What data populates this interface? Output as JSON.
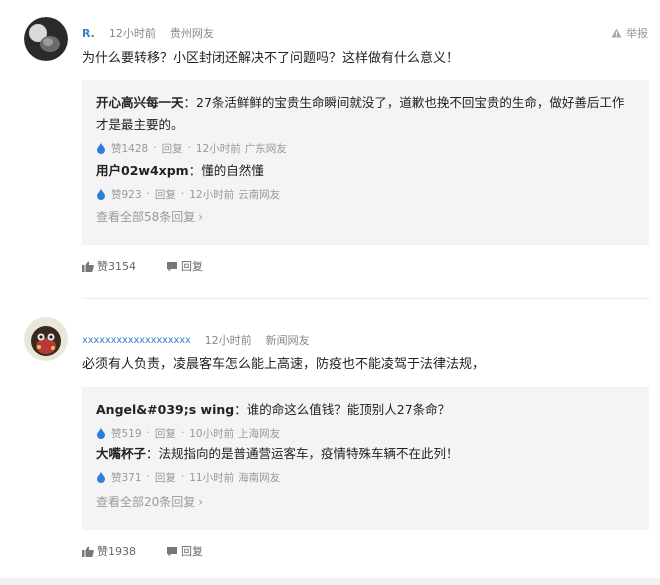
{
  "colors": {
    "accent": "#3e7fcc",
    "like_icon": "#2f7ddb",
    "reply_bg": "#f4f4f4",
    "muted": "#999999"
  },
  "comments": [
    {
      "username": "R.",
      "time": "12小时前",
      "location": "贵州网友",
      "report_label": "举报",
      "text": "为什么要转移？小区封闭还解决不了问题吗？这样做有什么意义！",
      "replies": [
        {
          "name": "开心高兴每一天",
          "text": "：27条活鲜鲜的宝贵生命瞬间就没了，道歉也挽不回宝贵的生命，做好善后工作才是最主要的。",
          "likes": "赞1428",
          "reply_label": "回复",
          "time": "12小时前",
          "location": "广东网友"
        },
        {
          "name": "用户02w4xpm",
          "text": "：懂的自然懂",
          "likes": "赞923",
          "reply_label": "回复",
          "time": "12小时前",
          "location": "云南网友"
        }
      ],
      "view_all": "查看全部58条回复",
      "likes": "赞3154",
      "reply_label": "回复"
    },
    {
      "username": "xxxxxxxxxxxxxxxxxxx",
      "time": "12小时前",
      "location": "新闻网友",
      "text": "必须有人负责，凌晨客车怎么能上高速，防疫也不能凌驾于法律法规，",
      "replies": [
        {
          "name": "Angel&#039;s wing",
          "text": "：谁的命这么值钱？能顶别人27条命？",
          "likes": "赞519",
          "reply_label": "回复",
          "time": "10小时前",
          "location": "上海网友"
        },
        {
          "name": "大嘴杯子",
          "text": "：法规指向的是普通营运客车，疫情特殊车辆不在此列！",
          "likes": "赞371",
          "reply_label": "回复",
          "time": "11小时前",
          "location": "海南网友"
        }
      ],
      "view_all": "查看全部20条回复",
      "likes": "赞1938",
      "reply_label": "回复"
    }
  ]
}
